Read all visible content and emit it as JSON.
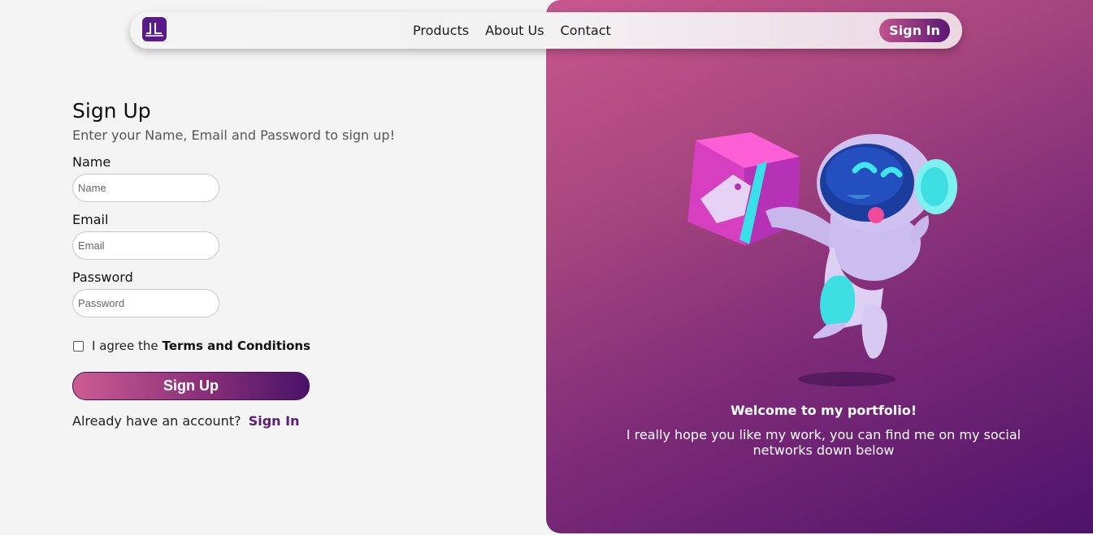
{
  "colors": {
    "brand": "#5a1a8a",
    "accent_start": "#c8578f",
    "accent_end": "#4e136a",
    "link": "#5c1c7a"
  },
  "navbar": {
    "logo_text": "JL",
    "links": [
      "Products",
      "About Us",
      "Contact"
    ],
    "signin_label": "Sign In"
  },
  "form": {
    "title": "Sign Up",
    "subtitle": "Enter your Name, Email and Password to sign up!",
    "fields": [
      {
        "label": "Name",
        "placeholder": "Name"
      },
      {
        "label": "Email",
        "placeholder": "Email"
      },
      {
        "label": "Password",
        "placeholder": "Password"
      }
    ],
    "agree_text": "I agree the",
    "terms_text": "Terms and Conditions",
    "submit_label": "Sign Up",
    "already_text": "Already have an account?",
    "signin_link": "Sign In"
  },
  "hero": {
    "image_icon": "robot-with-gift-box-illustration",
    "welcome_title": "Welcome to my portfolio!",
    "welcome_body": "I really hope you like my work, you can find me on my social networks down below"
  }
}
